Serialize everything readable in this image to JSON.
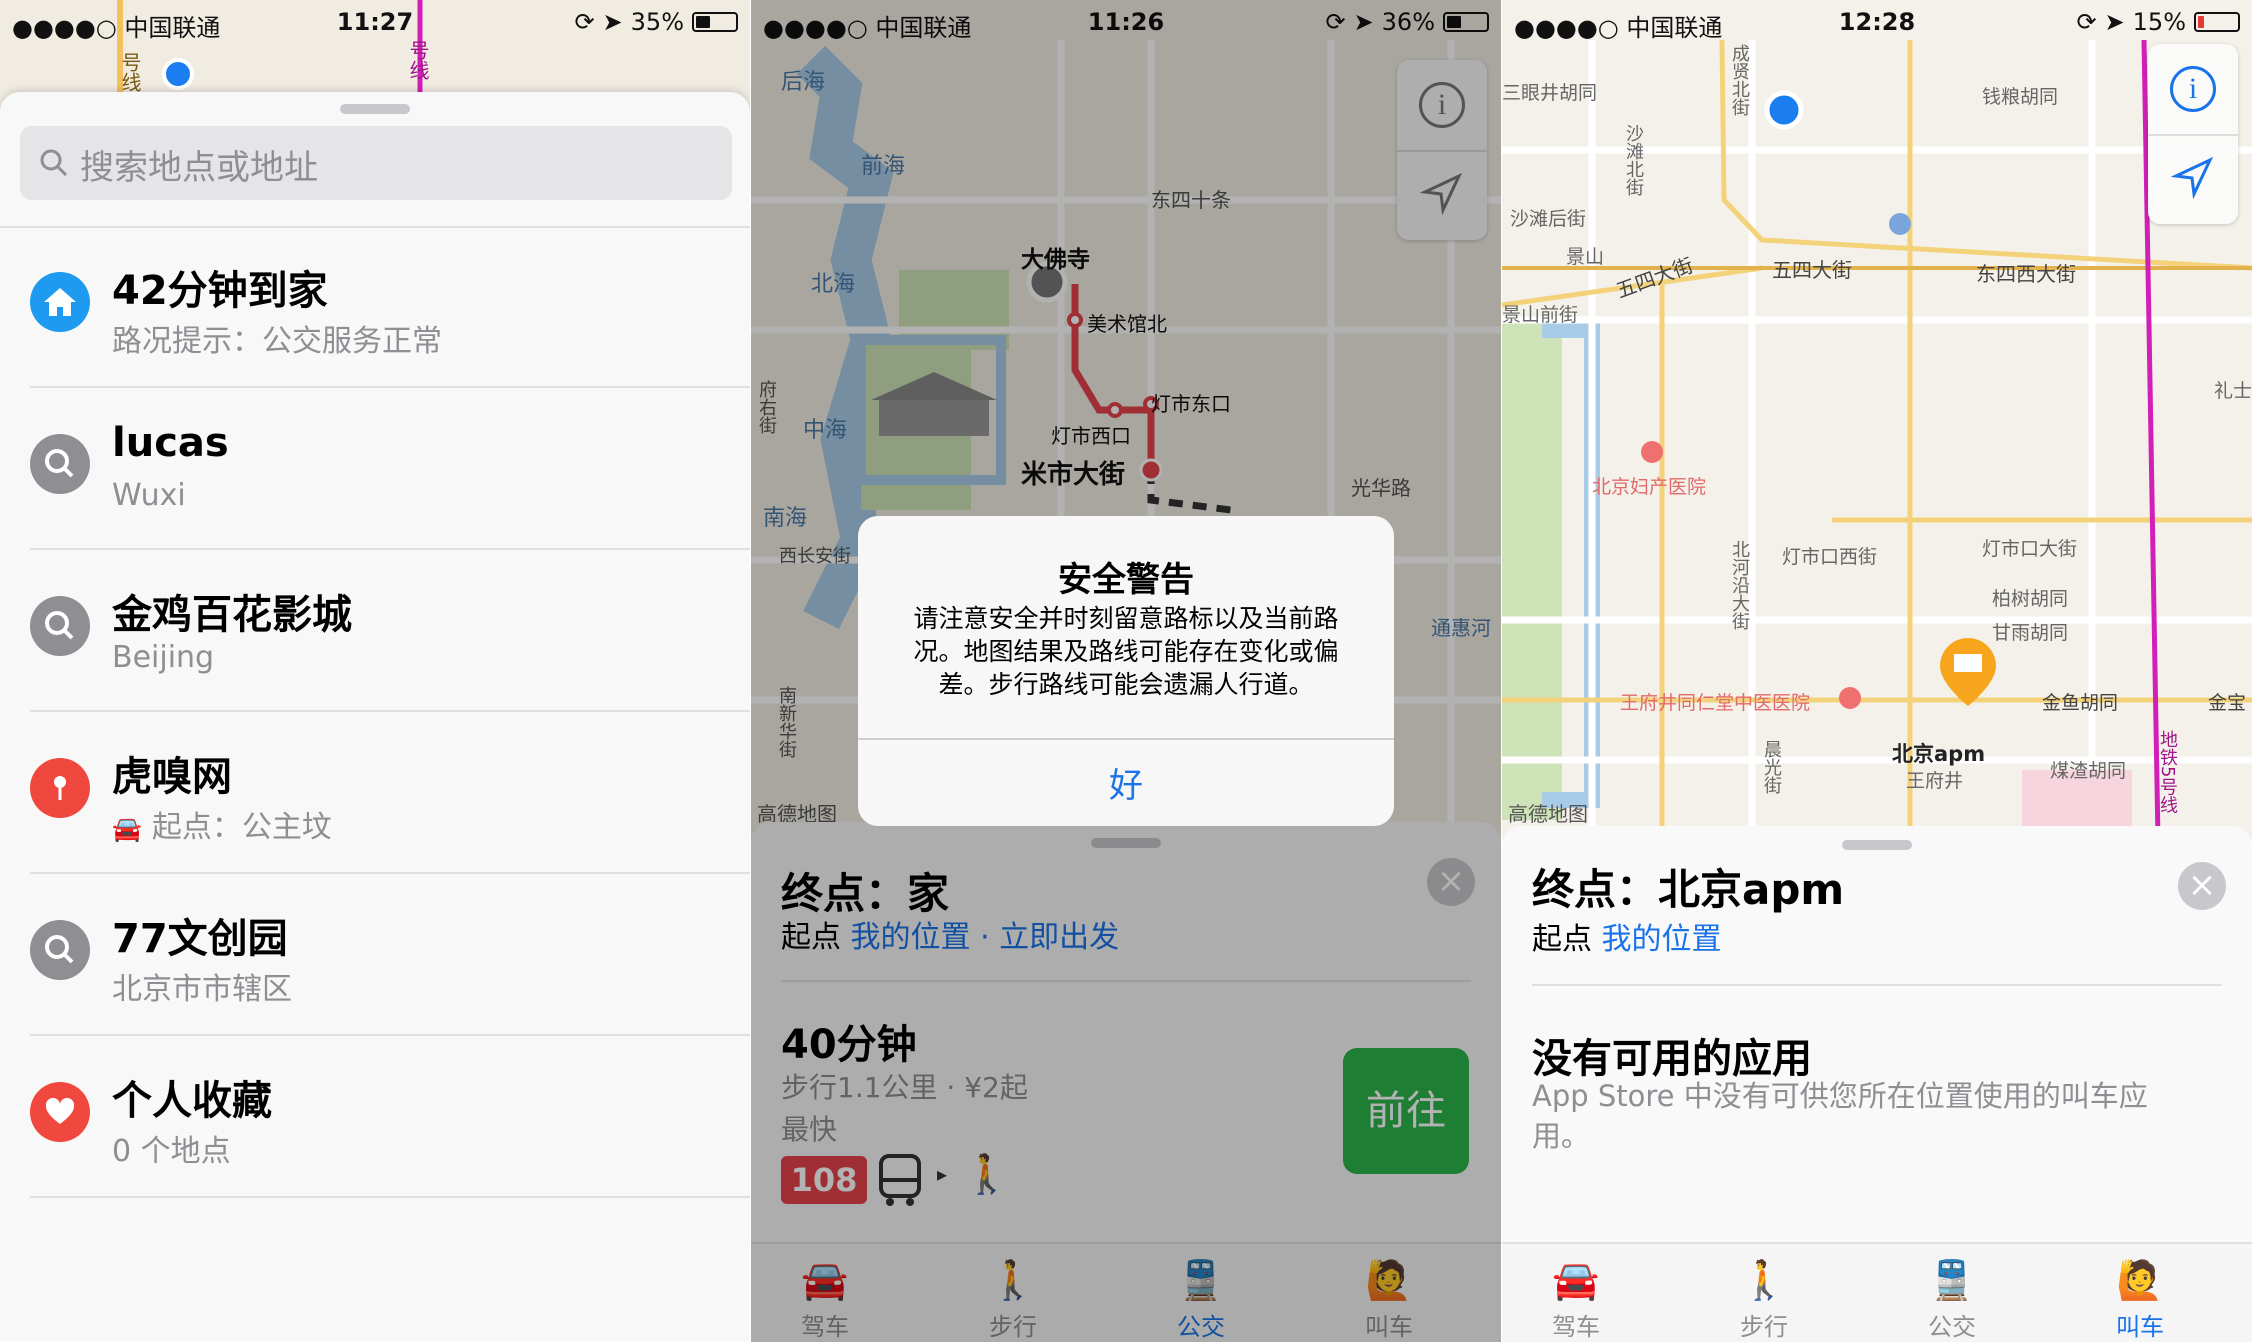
{
  "panel1": {
    "status": {
      "carrier": "●●●●○ 中国联通",
      "time": "11:27",
      "battery": "35%"
    },
    "map_labels": {
      "line_a": "号线",
      "line_b": "号线"
    },
    "search": {
      "placeholder": "搜索地点或地址"
    },
    "items": [
      {
        "title": "42分钟到家",
        "subtitle": "路况提示：公交服务正常",
        "icon": "home-icon",
        "color": "#1e9bf0"
      },
      {
        "title": "lucas",
        "subtitle": "Wuxi",
        "icon": "search-icon",
        "color": "#8e8e93"
      },
      {
        "title": "金鸡百花影城",
        "subtitle": "Beijing",
        "icon": "search-icon",
        "color": "#8e8e93"
      },
      {
        "title": "虎嗅网",
        "subtitle": "起点：公主坟",
        "icon": "pin-icon",
        "color": "#f0483e"
      },
      {
        "title": "77文创园",
        "subtitle": "北京市市辖区",
        "icon": "search-icon",
        "color": "#8e8e93"
      },
      {
        "title": "个人收藏",
        "subtitle": "0 个地点",
        "icon": "heart-icon",
        "color": "#f0483e"
      }
    ]
  },
  "panel2": {
    "status": {
      "carrier": "●●●●○ 中国联通",
      "time": "11:26",
      "battery": "36%"
    },
    "map_labels": {
      "houhai": "后海",
      "qianhai": "前海",
      "beihai": "北海",
      "zhonghai": "中海",
      "nanhai": "南海",
      "dongsishitiao": "东四十条",
      "dafosi": "大佛寺",
      "meishuguanbei": "美术馆北",
      "dengshidongkou": "灯市东口",
      "dengshixikou": "灯市西口",
      "mishidajie": "米市大街",
      "guanghualu": "光华路",
      "xichanganjie": "西长安街",
      "tonghuihe": "通惠河",
      "nanxinhuajie": "南新华街",
      "fuyoujie": "府右街",
      "brand": "高德地图"
    },
    "alert": {
      "title": "安全警告",
      "body": "请注意安全并时刻留意路标以及当前路况。地图结果及路线可能存在变化或偏差。步行路线可能会遗漏人行道。",
      "ok": "好"
    },
    "sheet": {
      "dest": "终点：家",
      "origin_label": "起点",
      "origin_value": "我的位置",
      "dot": "·",
      "depart": "立即出发",
      "duration": "40分钟",
      "detail": "步行1.1公里 · ¥2起",
      "tag": "最快",
      "bus_number": "108",
      "go": "前往"
    }
  },
  "panel3": {
    "status": {
      "carrier": "●●●●○ 中国联通",
      "time": "12:28",
      "battery": "15%"
    },
    "map_labels": {
      "zhihuan": "三眼井胡同",
      "qianliang": "钱粮胡同",
      "shatanbei": "沙滩北街",
      "shatanhou": "沙滩后街",
      "jingshan": "景山",
      "wusi": "五四大街",
      "wusi2": "五四大街",
      "dongsixi": "东四西大街",
      "jingshanqian": "景山前街",
      "lishi": "礼士",
      "fuchan": "北京妇产医院",
      "dengshikouxi": "灯市口西街",
      "dengshikoudajie": "灯市口大街",
      "baishu": "柏树胡同",
      "ganyu": "甘雨胡同",
      "beiheyan": "北河沿大街",
      "renren": "王府井同仁堂中医医院",
      "jinyu": "金鱼胡同",
      "jinbao": "金宝",
      "apm": "北京apm",
      "wangfujing": "王府井",
      "meizha": "煤渣胡同",
      "line5": "地铁5号线",
      "chengxian": "成贤北街",
      "chenguang": "晨光街",
      "brand": "高德地图"
    },
    "sheet": {
      "dest": "终点：北京apm",
      "origin_label": "起点",
      "origin_value": "我的位置",
      "title": "没有可用的应用",
      "body": "App Store 中没有可供您所在位置使用的叫车应用。"
    }
  },
  "tabs": [
    "驾车",
    "步行",
    "公交",
    "叫车"
  ],
  "colors": {
    "accent": "#1a73e8",
    "green": "#2ab54b",
    "red": "#f0483e"
  }
}
